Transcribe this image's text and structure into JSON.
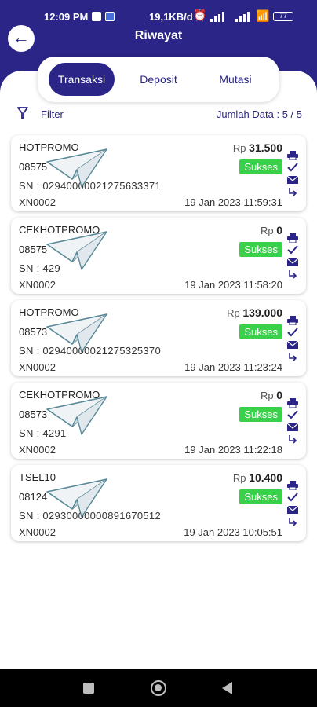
{
  "status_bar": {
    "time": "12:09 PM",
    "net_speed": "19,1KB/d",
    "battery": "77",
    "icons": [
      "notification-icon",
      "app-icon",
      "alarm-icon",
      "signal-icon",
      "signal-icon",
      "wifi-icon",
      "battery-icon"
    ]
  },
  "header": {
    "title": "Riwayat",
    "back_icon": "arrow-left-icon"
  },
  "tabs": [
    {
      "label": "Transaksi",
      "active": true
    },
    {
      "label": "Deposit",
      "active": false
    },
    {
      "label": "Mutasi",
      "active": false
    }
  ],
  "filter": {
    "label": "Filter",
    "icon": "filter-icon",
    "count_text": "Jumlah Data : 5 / 5"
  },
  "colors": {
    "primary": "#2a2587",
    "success": "#3ad14a",
    "white": "#ffffff"
  },
  "transactions": [
    {
      "product": "HOTPROMO",
      "currency": "Rp",
      "amount": "31.500",
      "phone": "08575",
      "status": "Sukses",
      "sn": "SN : 02940000021275633371",
      "code": "XN0002",
      "date": "19 Jan 2023 11:59:31"
    },
    {
      "product": "CEKHOTPROMO",
      "currency": "Rp",
      "amount": "0",
      "phone": "08575",
      "status": "Sukses",
      "sn": "SN : 429",
      "code": "XN0002",
      "date": "19 Jan 2023 11:58:20"
    },
    {
      "product": "HOTPROMO",
      "currency": "Rp",
      "amount": "139.000",
      "phone": "08573",
      "status": "Sukses",
      "sn": "SN : 02940000021275325370",
      "code": "XN0002",
      "date": "19 Jan 2023 11:23:24"
    },
    {
      "product": "CEKHOTPROMO",
      "currency": "Rp",
      "amount": "0",
      "phone": "08573",
      "status": "Sukses",
      "sn": "SN : 4291",
      "code": "XN0002",
      "date": "19 Jan 2023 11:22:18"
    },
    {
      "product": "TSEL10",
      "currency": "Rp",
      "amount": "10.400",
      "phone": "08124",
      "status": "Sukses",
      "sn": "SN : 02930000000891670512",
      "code": "XN0002",
      "date": "19 Jan 2023 10:05:51"
    }
  ],
  "card_action_icons": [
    "print-icon",
    "checkmark-icon",
    "mail-icon",
    "share-icon"
  ],
  "watermark_icon": "paper-plane-icon",
  "nav_bar": {
    "icons": [
      "recent-apps-icon",
      "home-icon",
      "back-icon"
    ]
  }
}
